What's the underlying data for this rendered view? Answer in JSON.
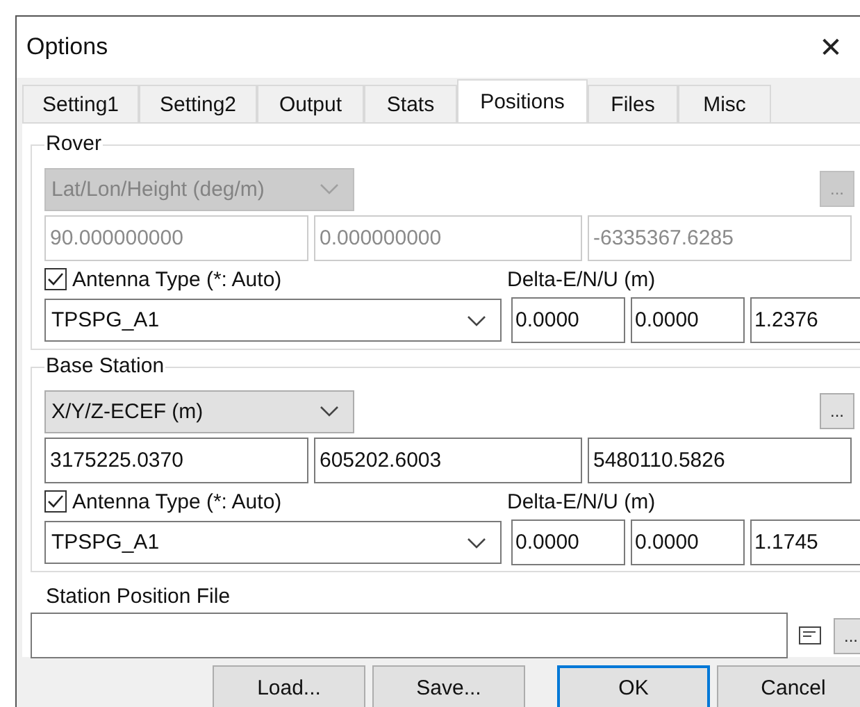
{
  "window": {
    "title": "Options",
    "close": "✕"
  },
  "tabs": [
    {
      "label": "Setting1",
      "selected": false
    },
    {
      "label": "Setting2",
      "selected": false
    },
    {
      "label": "Output",
      "selected": false
    },
    {
      "label": "Stats",
      "selected": false
    },
    {
      "label": "Positions",
      "selected": true
    },
    {
      "label": "Files",
      "selected": false
    },
    {
      "label": "Misc",
      "selected": false
    }
  ],
  "groups": [
    {
      "title": "Rover",
      "coordinate_type": {
        "value": "Lat/Lon/Height (deg/m)",
        "disabled": true
      },
      "browse_button": {
        "label": "...",
        "disabled": true
      },
      "coordinates": [
        {
          "value": "90.000000000",
          "disabled": true
        },
        {
          "value": "0.000000000",
          "disabled": true
        },
        {
          "value": "-6335367.6285",
          "disabled": true
        }
      ],
      "antenna_checkbox": {
        "label": "Antenna Type (*: Auto)",
        "checked": true
      },
      "delta_label": "Delta-E/N/U (m)",
      "antenna_type": "TPSPG_A1",
      "deltas": [
        "0.0000",
        "0.0000",
        "1.2376"
      ]
    },
    {
      "title": "Base Station",
      "coordinate_type": {
        "value": "X/Y/Z-ECEF (m)",
        "disabled": false
      },
      "browse_button": {
        "label": "...",
        "disabled": false
      },
      "coordinates": [
        {
          "value": "3175225.0370",
          "disabled": false
        },
        {
          "value": "605202.6003",
          "disabled": false
        },
        {
          "value": "5480110.5826",
          "disabled": false
        }
      ],
      "antenna_checkbox": {
        "label": "Antenna Type (*: Auto)",
        "checked": true
      },
      "delta_label": "Delta-E/N/U (m)",
      "antenna_type": "TPSPG_A1",
      "deltas": [
        "0.0000",
        "0.0000",
        "1.1745"
      ]
    }
  ],
  "station_position_file": {
    "label": "Station Position File",
    "browse_button": "..."
  },
  "buttons": [
    {
      "label": "Load...",
      "default": false
    },
    {
      "label": "Save...",
      "default": false
    },
    {
      "label": "OK",
      "default": true
    },
    {
      "label": "Cancel",
      "default": false
    }
  ]
}
